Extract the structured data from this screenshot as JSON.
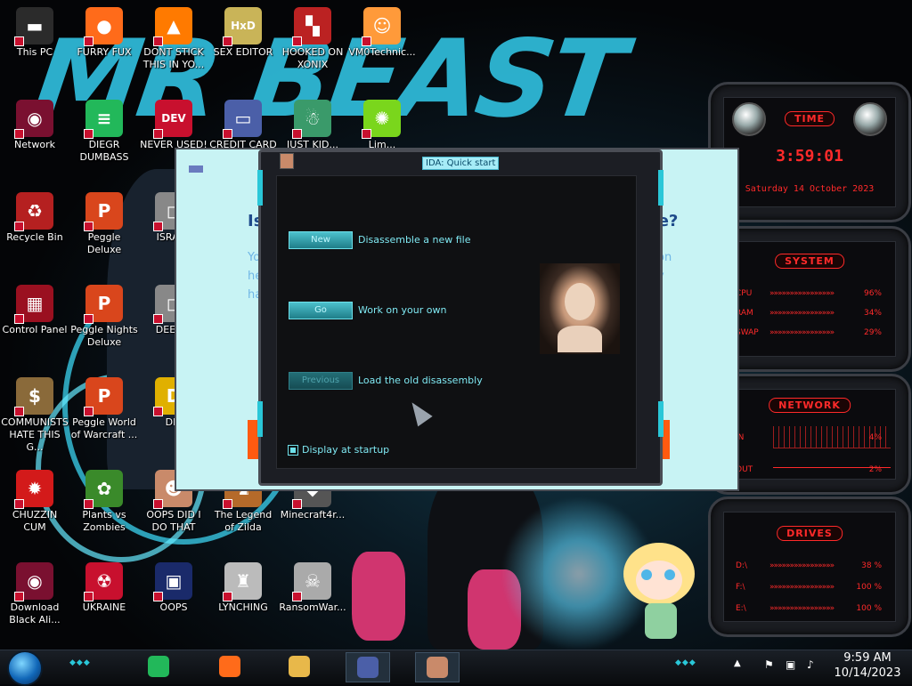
{
  "desktop": {
    "icons": [
      {
        "id": "this-pc",
        "label": "This PC",
        "glyph": "▬",
        "color": "#2b2b2b"
      },
      {
        "id": "furry-fux",
        "label": "FURRY FUX",
        "glyph": "●",
        "color": "#ff6b1a"
      },
      {
        "id": "dont-stick",
        "label": "DONT STICK THIS IN YO...",
        "glyph": "▲",
        "color": "#ff7a00"
      },
      {
        "id": "sex-editor",
        "label": "SEX EDITOR",
        "glyph": "HxD",
        "color": "#c9b458"
      },
      {
        "id": "hooked-on-xonix",
        "label": "HOOKED ON XONIX",
        "glyph": "▚",
        "color": "#b22"
      },
      {
        "id": "vm0",
        "label": "VM0Technic...",
        "glyph": "☺",
        "color": "#ff9a3a"
      },
      {
        "id": "network",
        "label": "Network",
        "glyph": "◉",
        "color": "#7a1030"
      },
      {
        "id": "diegr-dumbass",
        "label": "DIEGR DUMBASS",
        "glyph": "≡",
        "color": "#22b85a"
      },
      {
        "id": "never-used",
        "label": "NEVER USED!",
        "glyph": "DEV",
        "color": "#c8102e"
      },
      {
        "id": "credit-card",
        "label": "CREDIT CARD",
        "glyph": "▭",
        "color": "#4b5fa8"
      },
      {
        "id": "just-kid",
        "label": "JUST KID...",
        "glyph": "☃",
        "color": "#3a9a6a"
      },
      {
        "id": "lime",
        "label": "Lim...",
        "glyph": "✺",
        "color": "#7ad61c"
      },
      {
        "id": "recycle-bin",
        "label": "Recycle Bin",
        "glyph": "♻",
        "color": "#b52020"
      },
      {
        "id": "peggle-deluxe",
        "label": "Peggle Deluxe",
        "glyph": "P",
        "color": "#d9461c"
      },
      {
        "id": "israel",
        "label": "ISRAI...",
        "glyph": "◻",
        "color": "#888"
      },
      {
        "id": "control-panel",
        "label": "Control Panel",
        "glyph": "▦",
        "color": "#9a1020"
      },
      {
        "id": "peggle-nights",
        "label": "Peggle Nights Deluxe",
        "glyph": "P",
        "color": "#d9461c"
      },
      {
        "id": "deez",
        "label": "DEEZ...",
        "glyph": "◻",
        "color": "#888"
      },
      {
        "id": "communists",
        "label": "COMMUNISTS HATE THIS G...",
        "glyph": "$",
        "color": "#8a6a3a"
      },
      {
        "id": "peggle-world",
        "label": "Peggle World of Warcraft ...",
        "glyph": "P",
        "color": "#d9461c"
      },
      {
        "id": "die",
        "label": "DIE",
        "glyph": "D",
        "color": "#e0b000"
      },
      {
        "id": "chuzzin-cum",
        "label": "CHUZZIN CUM",
        "glyph": "✹",
        "color": "#d31a1a"
      },
      {
        "id": "plants-vs-zombies",
        "label": "Plants vs Zombies",
        "glyph": "✿",
        "color": "#3a8a2a"
      },
      {
        "id": "oops-did-i",
        "label": "OOPS DID I DO THAT",
        "glyph": "☻",
        "color": "#c98a6a"
      },
      {
        "id": "legend-of-zilda",
        "label": "The Legend of Zilda",
        "glyph": "♞",
        "color": "#b56a2a"
      },
      {
        "id": "minecraft4r",
        "label": "Minecraft4r...",
        "glyph": "◆",
        "color": "#555"
      },
      {
        "id": "download-black-ali",
        "label": "Download Black Ali...",
        "glyph": "◉",
        "color": "#7a1030"
      },
      {
        "id": "ukraine",
        "label": "UKRAINE",
        "glyph": "☢",
        "color": "#c8102e"
      },
      {
        "id": "oops",
        "label": "OOPS",
        "glyph": "▣",
        "color": "#1a2a6a"
      },
      {
        "id": "lynching",
        "label": "LYNCHING",
        "glyph": "♜",
        "color": "#bbb"
      },
      {
        "id": "ransomwar",
        "label": "RansomWar...",
        "glyph": "☠",
        "color": "#aaa"
      }
    ]
  },
  "ida_dialog": {
    "title": "IDA: Quick start",
    "buttons": [
      {
        "label": "New",
        "description": "Disassemble a new file",
        "enabled": true
      },
      {
        "label": "Go",
        "description": "Work on your own",
        "enabled": true
      },
      {
        "label": "Previous",
        "description": "Load the old disassembly",
        "enabled": false
      }
    ],
    "display_at_startup_label": "Display at startup",
    "display_at_startup_checked": true,
    "background_heading_left": "Is",
    "background_heading_right": "se?",
    "background_text_left": [
      "Yo",
      "he",
      "hav"
    ],
    "background_text_right": [
      "on",
      "y"
    ]
  },
  "gadgets": {
    "time": {
      "title": "Time",
      "clock": "3:59:01",
      "date": "Saturday 14 October 2023"
    },
    "system": {
      "title": "System",
      "rows": [
        {
          "label": "CPU",
          "value": "96%"
        },
        {
          "label": "RAM",
          "value": "34%"
        },
        {
          "label": "SWAP",
          "value": "29%"
        }
      ]
    },
    "network": {
      "title": "Network",
      "rows": [
        {
          "label": "IN",
          "value": "4%"
        },
        {
          "label": "OUT",
          "value": "2%"
        }
      ]
    },
    "drives": {
      "title": "Drives",
      "rows": [
        {
          "label": "D:\\",
          "value": "38 %"
        },
        {
          "label": "F:\\",
          "value": "100 %"
        },
        {
          "label": "E:\\",
          "value": "100 %"
        }
      ]
    }
  },
  "taskbar": {
    "time": "9:59 AM",
    "date": "10/14/2023",
    "apps": [
      {
        "name": "app-green",
        "color": "#22b85a"
      },
      {
        "name": "firefox",
        "color": "#ff6b1a"
      },
      {
        "name": "file-explorer",
        "color": "#e8b84a"
      },
      {
        "name": "credit-card",
        "color": "#4b5fa8"
      },
      {
        "name": "ida-pro",
        "color": "#c98a6a"
      }
    ]
  }
}
